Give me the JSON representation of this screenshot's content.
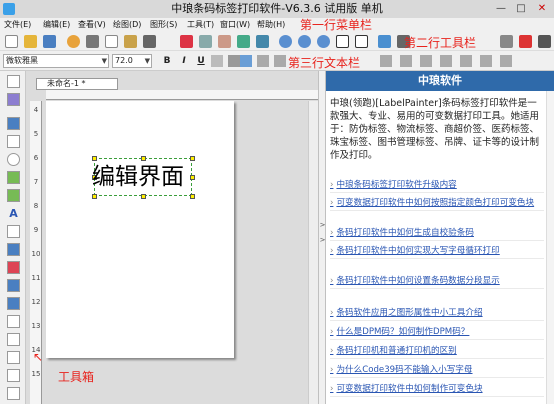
{
  "window": {
    "title": "中琅条码标签打印软件-V6.3.6 试用版 单机",
    "controls": [
      "—",
      "□",
      "✕"
    ]
  },
  "menu": [
    "文件(E)",
    "编辑(E)",
    "查看(V)",
    "绘图(D)",
    "图形(S)",
    "工具(T)",
    "窗口(W)",
    "帮助(H)"
  ],
  "annotations": {
    "menu": "第一行菜单栏",
    "toolbar": "第二行工具栏",
    "textbar": "第三行文本栏",
    "toolbox": "工具箱"
  },
  "textbar": {
    "font": "微软雅黑",
    "size": "72.0",
    "bold": "B",
    "italic": "I",
    "underline": "U"
  },
  "document": {
    "tab": "未命名-1 *",
    "label_text": "编辑界面",
    "ruler_left": [
      "4",
      "5",
      "6",
      "7",
      "8",
      "9",
      "10",
      "11",
      "12",
      "13",
      "14",
      "15"
    ]
  },
  "side": {
    "header": "中琅软件",
    "description": "中琅(领跑)[LabelPainter]条码标签打印软件是一款强大、专业、易用的可变数据打印工具。她适用于：防伪标签、物流标签、商超价签、医药标签、珠宝标签、图书管理标签、吊牌、证卡等的设计制作及打印。",
    "links": [
      "中琅条码标签打印软件升级内容",
      "可变数据打印软件中如何按照指定颜色打印可变色块",
      "条码打印软件中如何生成自校验条码",
      "条码打印软件中如何实现大写字母循环打印",
      "条码打印软件中如何设置条码数据分段显示",
      "条码软件应用之图形属性中小工具介绍",
      "什么是DPM码？如何制作DPM码？",
      "条码打印机和普通打印机的区别",
      "为什么Code39码不能输入小写字母",
      "可变数据打印软件中如何制作可变色块"
    ]
  },
  "colors": {
    "accent": "#2f6aaa",
    "annotation": "#e8231d",
    "link": "#2a56b3"
  }
}
